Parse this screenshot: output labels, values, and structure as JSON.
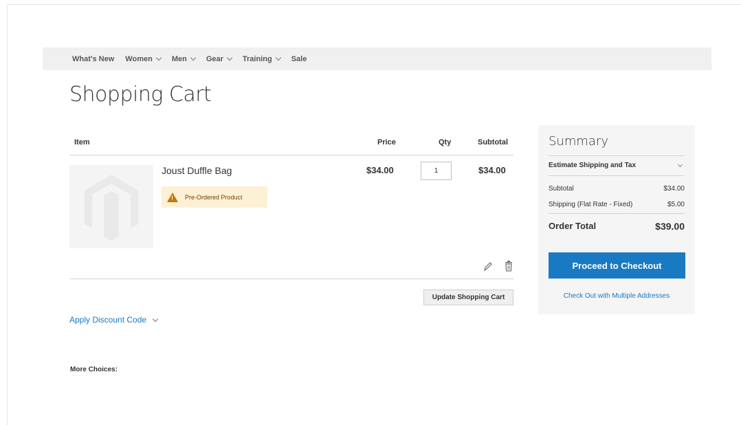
{
  "nav": {
    "items": [
      {
        "label": "What's New",
        "has_dropdown": false
      },
      {
        "label": "Women",
        "has_dropdown": true
      },
      {
        "label": "Men",
        "has_dropdown": true
      },
      {
        "label": "Gear",
        "has_dropdown": true
      },
      {
        "label": "Training",
        "has_dropdown": true
      },
      {
        "label": "Sale",
        "has_dropdown": false
      }
    ]
  },
  "page": {
    "title": "Shopping Cart"
  },
  "cart": {
    "headers": {
      "item": "Item",
      "price": "Price",
      "qty": "Qty",
      "subtotal": "Subtotal"
    },
    "items": [
      {
        "name": "Joust Duffle Bag",
        "notice": "Pre-Ordered Product",
        "price": "$34.00",
        "qty": "1",
        "subtotal": "$34.00"
      }
    ],
    "update_label": "Update Shopping Cart",
    "discount_label": "Apply Discount Code",
    "more_choices": "More Choices:"
  },
  "summary": {
    "title": "Summary",
    "estimate_label": "Estimate Shipping and Tax",
    "subtotal_label": "Subtotal",
    "subtotal_value": "$34.00",
    "shipping_label": "Shipping (Flat Rate - Fixed)",
    "shipping_value": "$5.00",
    "total_label": "Order Total",
    "total_value": "$39.00",
    "checkout_label": "Proceed to Checkout",
    "multi_label": "Check Out with Multiple Addresses"
  },
  "colors": {
    "accent": "#1979c3",
    "notice_bg": "#fdf0d5",
    "warning": "#c07600",
    "summary_bg": "#f5f5f5",
    "nav_bg": "#f0f0f0"
  },
  "icons": {
    "product_placeholder": "magento-logo-icon",
    "edit": "pencil-icon",
    "delete": "trash-icon",
    "notice": "warning-icon",
    "dropdown": "chevron-down-icon"
  }
}
